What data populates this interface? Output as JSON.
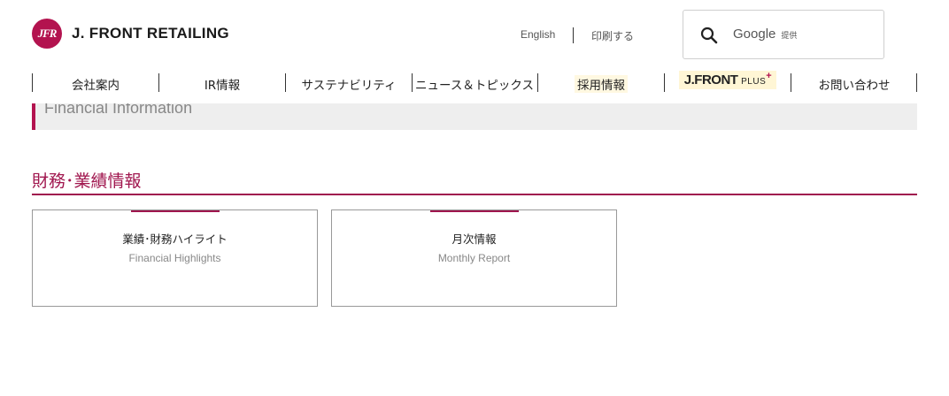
{
  "header": {
    "logo_mark": "JFR",
    "logo_text": "J. FRONT RETAILING",
    "links": {
      "english": "English",
      "print": "印刷する"
    },
    "search": {
      "provider": "Google",
      "provided_label": "提供"
    }
  },
  "nav": {
    "items": [
      {
        "label": "会社案内"
      },
      {
        "label": "IR情報"
      },
      {
        "label": "サステナビリティ"
      },
      {
        "label": "ニュース＆トピックス"
      },
      {
        "label": "採用情報"
      },
      {
        "label_main": "J.FRONT",
        "label_small": "PLUS",
        "label_plus": "+"
      },
      {
        "label": "お問い合わせ"
      }
    ]
  },
  "banner": {
    "text": "Financial Information"
  },
  "section": {
    "title": "財務･業績情報"
  },
  "cards": [
    {
      "title": "業績･財務ハイライト",
      "subtitle": "Financial Highlights"
    },
    {
      "title": "月次情報",
      "subtitle": "Monthly Report"
    }
  ],
  "colors": {
    "brand": "#b3134f",
    "accent": "#a0164e",
    "banner_bg": "#eeeeee"
  }
}
